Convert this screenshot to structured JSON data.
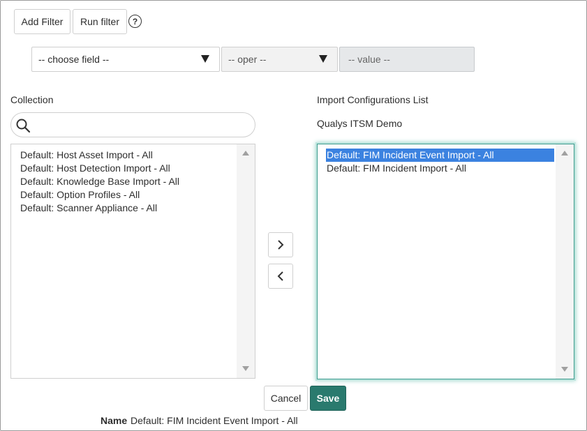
{
  "toolbar": {
    "add_filter_label": "Add Filter",
    "run_filter_label": "Run filter",
    "help_symbol": "?"
  },
  "filter": {
    "field_value": "-- choose field --",
    "oper_value": "-- oper --",
    "value_placeholder": "-- value --"
  },
  "collection": {
    "label": "Collection",
    "search_value": "",
    "items": [
      "Default: Host Asset Import - All",
      "Default: Host Detection Import - All",
      "Default: Knowledge Base Import - All",
      "Default: Option Profiles - All",
      "Default: Scanner Appliance - All"
    ]
  },
  "selected_list": {
    "label": "Import Configurations List",
    "subtitle": "Qualys ITSM Demo",
    "items": [
      "Default: FIM Incident Event Import - All",
      "Default: FIM Incident Import - All"
    ],
    "selected_index": 0
  },
  "actions": {
    "cancel_label": "Cancel",
    "save_label": "Save"
  },
  "name_field": {
    "label": "Name",
    "value": "Default: FIM Incident Event Import - All"
  },
  "colors": {
    "save_bg": "#2a7a6e",
    "selection_bg": "#3b82e0",
    "focus_ring": "#5fbfb0"
  }
}
